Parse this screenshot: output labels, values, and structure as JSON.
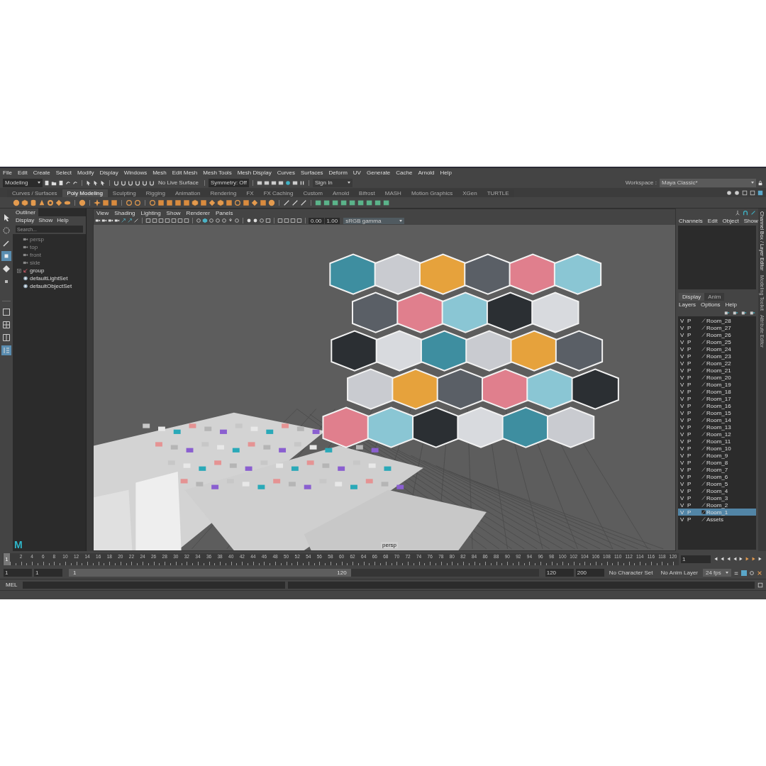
{
  "menu_bar": [
    "File",
    "Edit",
    "Create",
    "Select",
    "Modify",
    "Display",
    "Windows",
    "Mesh",
    "Edit Mesh",
    "Mesh Tools",
    "Mesh Display",
    "Curves",
    "Surfaces",
    "Deform",
    "UV",
    "Generate",
    "Cache",
    "Arnold",
    "Help"
  ],
  "status_line": {
    "mode": "Modeling",
    "live_surface": "No Live Surface",
    "symmetry": "Symmetry: Off",
    "sign_in": "Sign In",
    "workspace_label": "Workspace :",
    "workspace": "Maya Classic*"
  },
  "shelf_tabs": [
    {
      "label": "Curves / Surfaces",
      "selected": false
    },
    {
      "label": "Poly Modeling",
      "selected": true
    },
    {
      "label": "Sculpting",
      "selected": false
    },
    {
      "label": "Rigging",
      "selected": false
    },
    {
      "label": "Animation",
      "selected": false
    },
    {
      "label": "Rendering",
      "selected": false
    },
    {
      "label": "FX",
      "selected": false
    },
    {
      "label": "FX Caching",
      "selected": false
    },
    {
      "label": "Custom",
      "selected": false
    },
    {
      "label": "Arnold",
      "selected": false
    },
    {
      "label": "Bifrost",
      "selected": false
    },
    {
      "label": "MASH",
      "selected": false
    },
    {
      "label": "Motion Graphics",
      "selected": false
    },
    {
      "label": "XGen",
      "selected": false
    },
    {
      "label": "TURTLE",
      "selected": false
    }
  ],
  "toolbox": [
    {
      "selected": false
    },
    {
      "selected": false
    },
    {
      "selected": false
    },
    {
      "selected": true
    },
    {
      "selected": false
    },
    {
      "selected": false
    }
  ],
  "outliner": {
    "tab": "Outliner",
    "menus": [
      "Display",
      "Show",
      "Help"
    ],
    "search": {
      "placeholder": "Search..."
    },
    "items": [
      {
        "label": "persp",
        "kind": "camera",
        "disabled": true
      },
      {
        "label": "top",
        "kind": "camera",
        "disabled": true
      },
      {
        "label": "front",
        "kind": "camera",
        "disabled": true
      },
      {
        "label": "side",
        "kind": "camera",
        "disabled": true
      },
      {
        "label": "group",
        "kind": "group",
        "disabled": false,
        "expanded": false
      },
      {
        "label": "defaultLightSet",
        "kind": "set",
        "disabled": false
      },
      {
        "label": "defaultObjectSet",
        "kind": "set",
        "disabled": false
      }
    ]
  },
  "logo": "M",
  "viewport": {
    "menus": [
      "View",
      "Shading",
      "Lighting",
      "Show",
      "Renderer",
      "Panels"
    ],
    "exposure": "0.00",
    "gamma": "1.00",
    "color_space": "sRGB gamma",
    "camera_label": "persp"
  },
  "channel_box": {
    "menus": [
      "Channels",
      "Edit",
      "Object",
      "Show"
    ]
  },
  "layer_editor": {
    "tabs": [
      {
        "label": "Display",
        "selected": true
      },
      {
        "label": "Anim",
        "selected": false
      }
    ],
    "menus": [
      "Layers",
      "Options",
      "Help"
    ],
    "layers": [
      {
        "v": "V",
        "p": "P",
        "name": "Room_28",
        "selected": false
      },
      {
        "v": "V",
        "p": "P",
        "name": "Room_27",
        "selected": false
      },
      {
        "v": "V",
        "p": "P",
        "name": "Room_26",
        "selected": false
      },
      {
        "v": "V",
        "p": "P",
        "name": "Room_25",
        "selected": false
      },
      {
        "v": "V",
        "p": "P",
        "name": "Room_24",
        "selected": false
      },
      {
        "v": "V",
        "p": "P",
        "name": "Room_23",
        "selected": false
      },
      {
        "v": "V",
        "p": "P",
        "name": "Room_22",
        "selected": false
      },
      {
        "v": "V",
        "p": "P",
        "name": "Room_21",
        "selected": false
      },
      {
        "v": "V",
        "p": "P",
        "name": "Room_20",
        "selected": false
      },
      {
        "v": "V",
        "p": "P",
        "name": "Room_19",
        "selected": false
      },
      {
        "v": "V",
        "p": "P",
        "name": "Room_18",
        "selected": false
      },
      {
        "v": "V",
        "p": "P",
        "name": "Room_17",
        "selected": false
      },
      {
        "v": "V",
        "p": "P",
        "name": "Room_16",
        "selected": false
      },
      {
        "v": "V",
        "p": "P",
        "name": "Room_15",
        "selected": false
      },
      {
        "v": "V",
        "p": "P",
        "name": "Room_14",
        "selected": false
      },
      {
        "v": "V",
        "p": "P",
        "name": "Room_13",
        "selected": false
      },
      {
        "v": "V",
        "p": "P",
        "name": "Room_12",
        "selected": false
      },
      {
        "v": "V",
        "p": "P",
        "name": "Room_11",
        "selected": false
      },
      {
        "v": "V",
        "p": "P",
        "name": "Room_10",
        "selected": false
      },
      {
        "v": "V",
        "p": "P",
        "name": "Room_9",
        "selected": false
      },
      {
        "v": "V",
        "p": "P",
        "name": "Room_8",
        "selected": false
      },
      {
        "v": "V",
        "p": "P",
        "name": "Room_7",
        "selected": false
      },
      {
        "v": "V",
        "p": "P",
        "name": "Room_6",
        "selected": false
      },
      {
        "v": "V",
        "p": "P",
        "name": "Room_5",
        "selected": false
      },
      {
        "v": "V",
        "p": "P",
        "name": "Room_4",
        "selected": false
      },
      {
        "v": "V",
        "p": "P",
        "name": "Room_3",
        "selected": false
      },
      {
        "v": "V",
        "p": "P",
        "name": "Room_2",
        "selected": false
      },
      {
        "v": "V",
        "p": "P",
        "name": "Room_1",
        "selected": true
      },
      {
        "v": "V",
        "p": "P",
        "name": "Assets",
        "selected": false
      }
    ]
  },
  "side_tabs": [
    "Channel Box / Layer Editor",
    "Modeling Toolkit",
    "Attribute Editor"
  ],
  "timeline": {
    "labels": [
      "2",
      "4",
      "6",
      "8",
      "10",
      "12",
      "14",
      "16",
      "18",
      "20",
      "22",
      "24",
      "26",
      "28",
      "30",
      "32",
      "34",
      "36",
      "38",
      "40",
      "42",
      "44",
      "46",
      "48",
      "50",
      "52",
      "54",
      "56",
      "58",
      "60",
      "62",
      "64",
      "66",
      "68",
      "70",
      "72",
      "74",
      "76",
      "78",
      "80",
      "82",
      "84",
      "86",
      "88",
      "90",
      "92",
      "94",
      "96",
      "98",
      "100",
      "102",
      "104",
      "106",
      "108",
      "110",
      "112",
      "114",
      "116",
      "118",
      "120"
    ],
    "current_marker": "1",
    "level": 0,
    "current_frame": "1"
  },
  "range": {
    "start": "1",
    "playback_start": "1",
    "slider_start": "1",
    "slider_end": "120",
    "level": 0.6,
    "playback_end": "120",
    "end": "200",
    "character_set": "No Character Set",
    "anim_layer": "No Anim Layer",
    "fps": "24 fps"
  },
  "command_line": {
    "language": "MEL"
  }
}
